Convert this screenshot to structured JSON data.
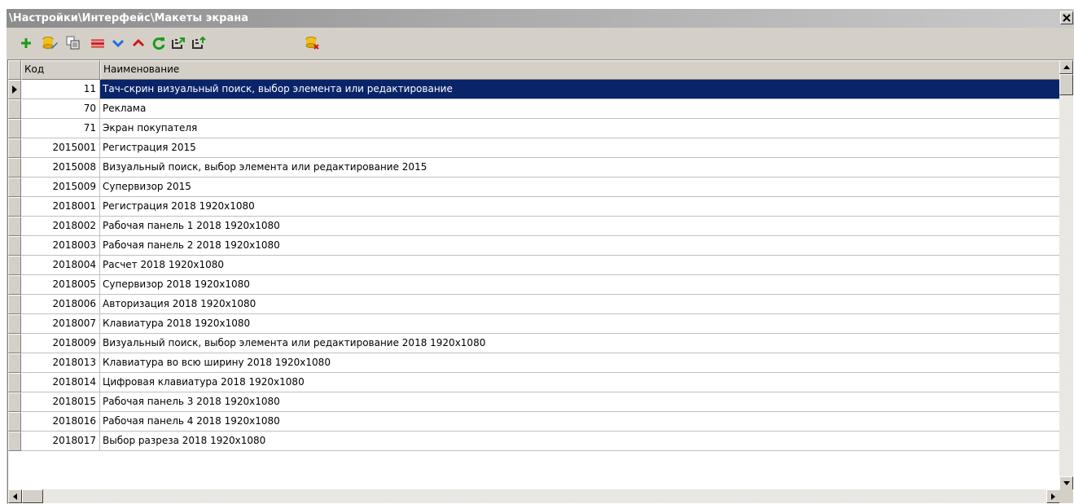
{
  "window": {
    "title": "\\Настройки\\Интерфейс\\Макеты экрана"
  },
  "toolbar": {
    "buttons": [
      {
        "icon": "plus-icon"
      },
      {
        "icon": "edit-icon"
      },
      {
        "icon": "copy-icon"
      },
      {
        "icon": "delete-icon"
      },
      {
        "icon": "chevron-down-icon"
      },
      {
        "icon": "chevron-up-icon"
      },
      {
        "icon": "refresh-icon"
      },
      {
        "icon": "export-icon"
      },
      {
        "icon": "import-icon"
      },
      {
        "icon": "clear-icon"
      }
    ]
  },
  "table": {
    "columns": {
      "code": "Код",
      "name": "Наименование"
    },
    "selected_row": 0,
    "rows": [
      {
        "code": "11",
        "name": "Тач-скрин визуальный поиск, выбор элемента или редактирование"
      },
      {
        "code": "70",
        "name": "Реклама"
      },
      {
        "code": "71",
        "name": "Экран покупателя"
      },
      {
        "code": "2015001",
        "name": "Регистрация 2015"
      },
      {
        "code": "2015008",
        "name": "Визуальный поиск, выбор элемента или редактирование 2015"
      },
      {
        "code": "2015009",
        "name": "Супервизор 2015"
      },
      {
        "code": "2018001",
        "name": "Регистрация 2018 1920x1080"
      },
      {
        "code": "2018002",
        "name": "Рабочая панель 1 2018 1920x1080"
      },
      {
        "code": "2018003",
        "name": "Рабочая панель 2 2018 1920x1080"
      },
      {
        "code": "2018004",
        "name": "Расчет 2018 1920x1080"
      },
      {
        "code": "2018005",
        "name": "Супервизор 2018 1920x1080"
      },
      {
        "code": "2018006",
        "name": "Авторизация 2018 1920x1080"
      },
      {
        "code": "2018007",
        "name": "Клавиатура 2018 1920x1080"
      },
      {
        "code": "2018009",
        "name": "Визуальный поиск, выбор элемента или редактирование 2018 1920x1080"
      },
      {
        "code": "2018013",
        "name": "Клавиатура во всю ширину 2018 1920x1080"
      },
      {
        "code": "2018014",
        "name": "Цифровая клавиатура 2018 1920x1080"
      },
      {
        "code": "2018015",
        "name": "Рабочая панель 3 2018 1920x1080"
      },
      {
        "code": "2018016",
        "name": "Рабочая панель 4 2018 1920x1080"
      },
      {
        "code": "2018017",
        "name": "Выбор разреза 2018 1920x1080"
      }
    ]
  },
  "colors": {
    "selection": "#0a246a",
    "face": "#d4d0c8"
  }
}
